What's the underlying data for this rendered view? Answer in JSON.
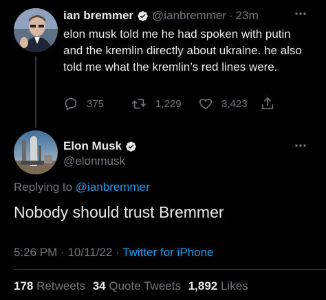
{
  "parent_tweet": {
    "author_name": "ian bremmer",
    "handle": "@ianbremmer",
    "separator": "·",
    "time_ago": "23m",
    "text": "elon musk told me he had spoken with putin and the kremlin directly about ukraine. he also told me what the kremlin’s red lines were.",
    "replies": "375",
    "retweets": "1,229",
    "likes": "3,423"
  },
  "main_tweet": {
    "author_name": "Elon Musk",
    "handle": "@elonmusk",
    "replying_label": "Replying to",
    "replying_to": "@ianbremmer",
    "text": "Nobody should trust Bremmer",
    "time": "5:26 PM",
    "sep1": "·",
    "date": "10/11/22",
    "sep2": "·",
    "source": "Twitter for iPhone"
  },
  "stats": {
    "retweets_count": "178",
    "retweets_label": "Retweets",
    "quotes_count": "34",
    "quotes_label": "Quote Tweets",
    "likes_count": "1,892",
    "likes_label": "Likes"
  },
  "colors": {
    "background": "#000000",
    "text": "#e7e9ea",
    "secondary": "#71767b",
    "accent": "#1d9bf0",
    "divider": "#2f3336"
  }
}
